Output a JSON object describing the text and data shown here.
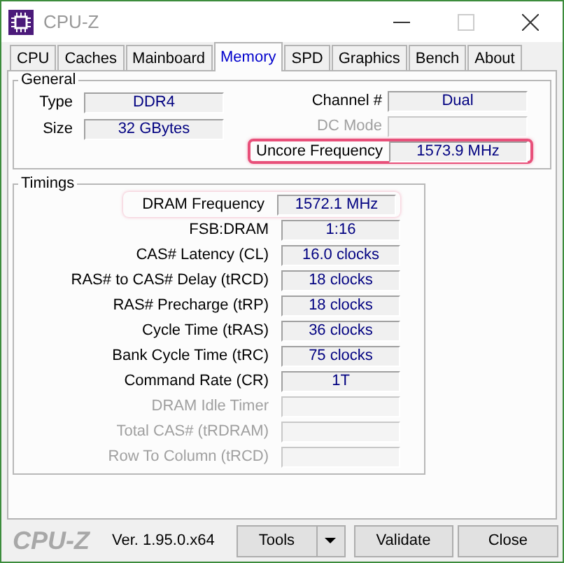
{
  "window": {
    "title": "CPU-Z"
  },
  "tabs": [
    {
      "label": "CPU",
      "selected": false
    },
    {
      "label": "Caches",
      "selected": false
    },
    {
      "label": "Mainboard",
      "selected": false
    },
    {
      "label": "Memory",
      "selected": true
    },
    {
      "label": "SPD",
      "selected": false
    },
    {
      "label": "Graphics",
      "selected": false
    },
    {
      "label": "Bench",
      "selected": false
    },
    {
      "label": "About",
      "selected": false
    }
  ],
  "general": {
    "title": "General",
    "left": [
      {
        "label": "Type",
        "value": "DDR4"
      },
      {
        "label": "Size",
        "value": "32 GBytes"
      }
    ],
    "right": [
      {
        "label": "Channel #",
        "value": "Dual",
        "disabled": false,
        "highlighted": false
      },
      {
        "label": "DC Mode",
        "disabled": true,
        "highlighted": false
      },
      {
        "label": "Uncore Frequency",
        "value": "1573.9 MHz",
        "disabled": false,
        "highlighted": true
      }
    ]
  },
  "timings": {
    "title": "Timings",
    "rows": [
      {
        "label": "DRAM Frequency",
        "value": "1572.1 MHz",
        "disabled": false,
        "highlighted": true
      },
      {
        "label": "FSB:DRAM",
        "value": "1:16",
        "disabled": false,
        "highlighted": false
      },
      {
        "label": "CAS# Latency (CL)",
        "value": "16.0 clocks",
        "disabled": false,
        "highlighted": false
      },
      {
        "label": "RAS# to CAS# Delay (tRCD)",
        "value": "18 clocks",
        "disabled": false,
        "highlighted": false
      },
      {
        "label": "RAS# Precharge (tRP)",
        "value": "18 clocks",
        "disabled": false,
        "highlighted": false
      },
      {
        "label": "Cycle Time (tRAS)",
        "value": "36 clocks",
        "disabled": false,
        "highlighted": false
      },
      {
        "label": "Bank Cycle Time (tRC)",
        "value": "75 clocks",
        "disabled": false,
        "highlighted": false
      },
      {
        "label": "Command Rate (CR)",
        "value": "1T",
        "disabled": false,
        "highlighted": false
      },
      {
        "label": "DRAM Idle Timer",
        "disabled": true,
        "highlighted": false
      },
      {
        "label": "Total CAS# (tRDRAM)",
        "disabled": true,
        "highlighted": false
      },
      {
        "label": "Row To Column (tRCD)",
        "disabled": true,
        "highlighted": false
      }
    ]
  },
  "footer": {
    "logo": "CPU-Z",
    "version": "Ver. 1.95.0.x64",
    "buttons": [
      {
        "label": "Tools",
        "kind": "dropdown"
      },
      {
        "label": "Validate",
        "kind": "plain"
      },
      {
        "label": "Close",
        "kind": "plain"
      }
    ]
  }
}
